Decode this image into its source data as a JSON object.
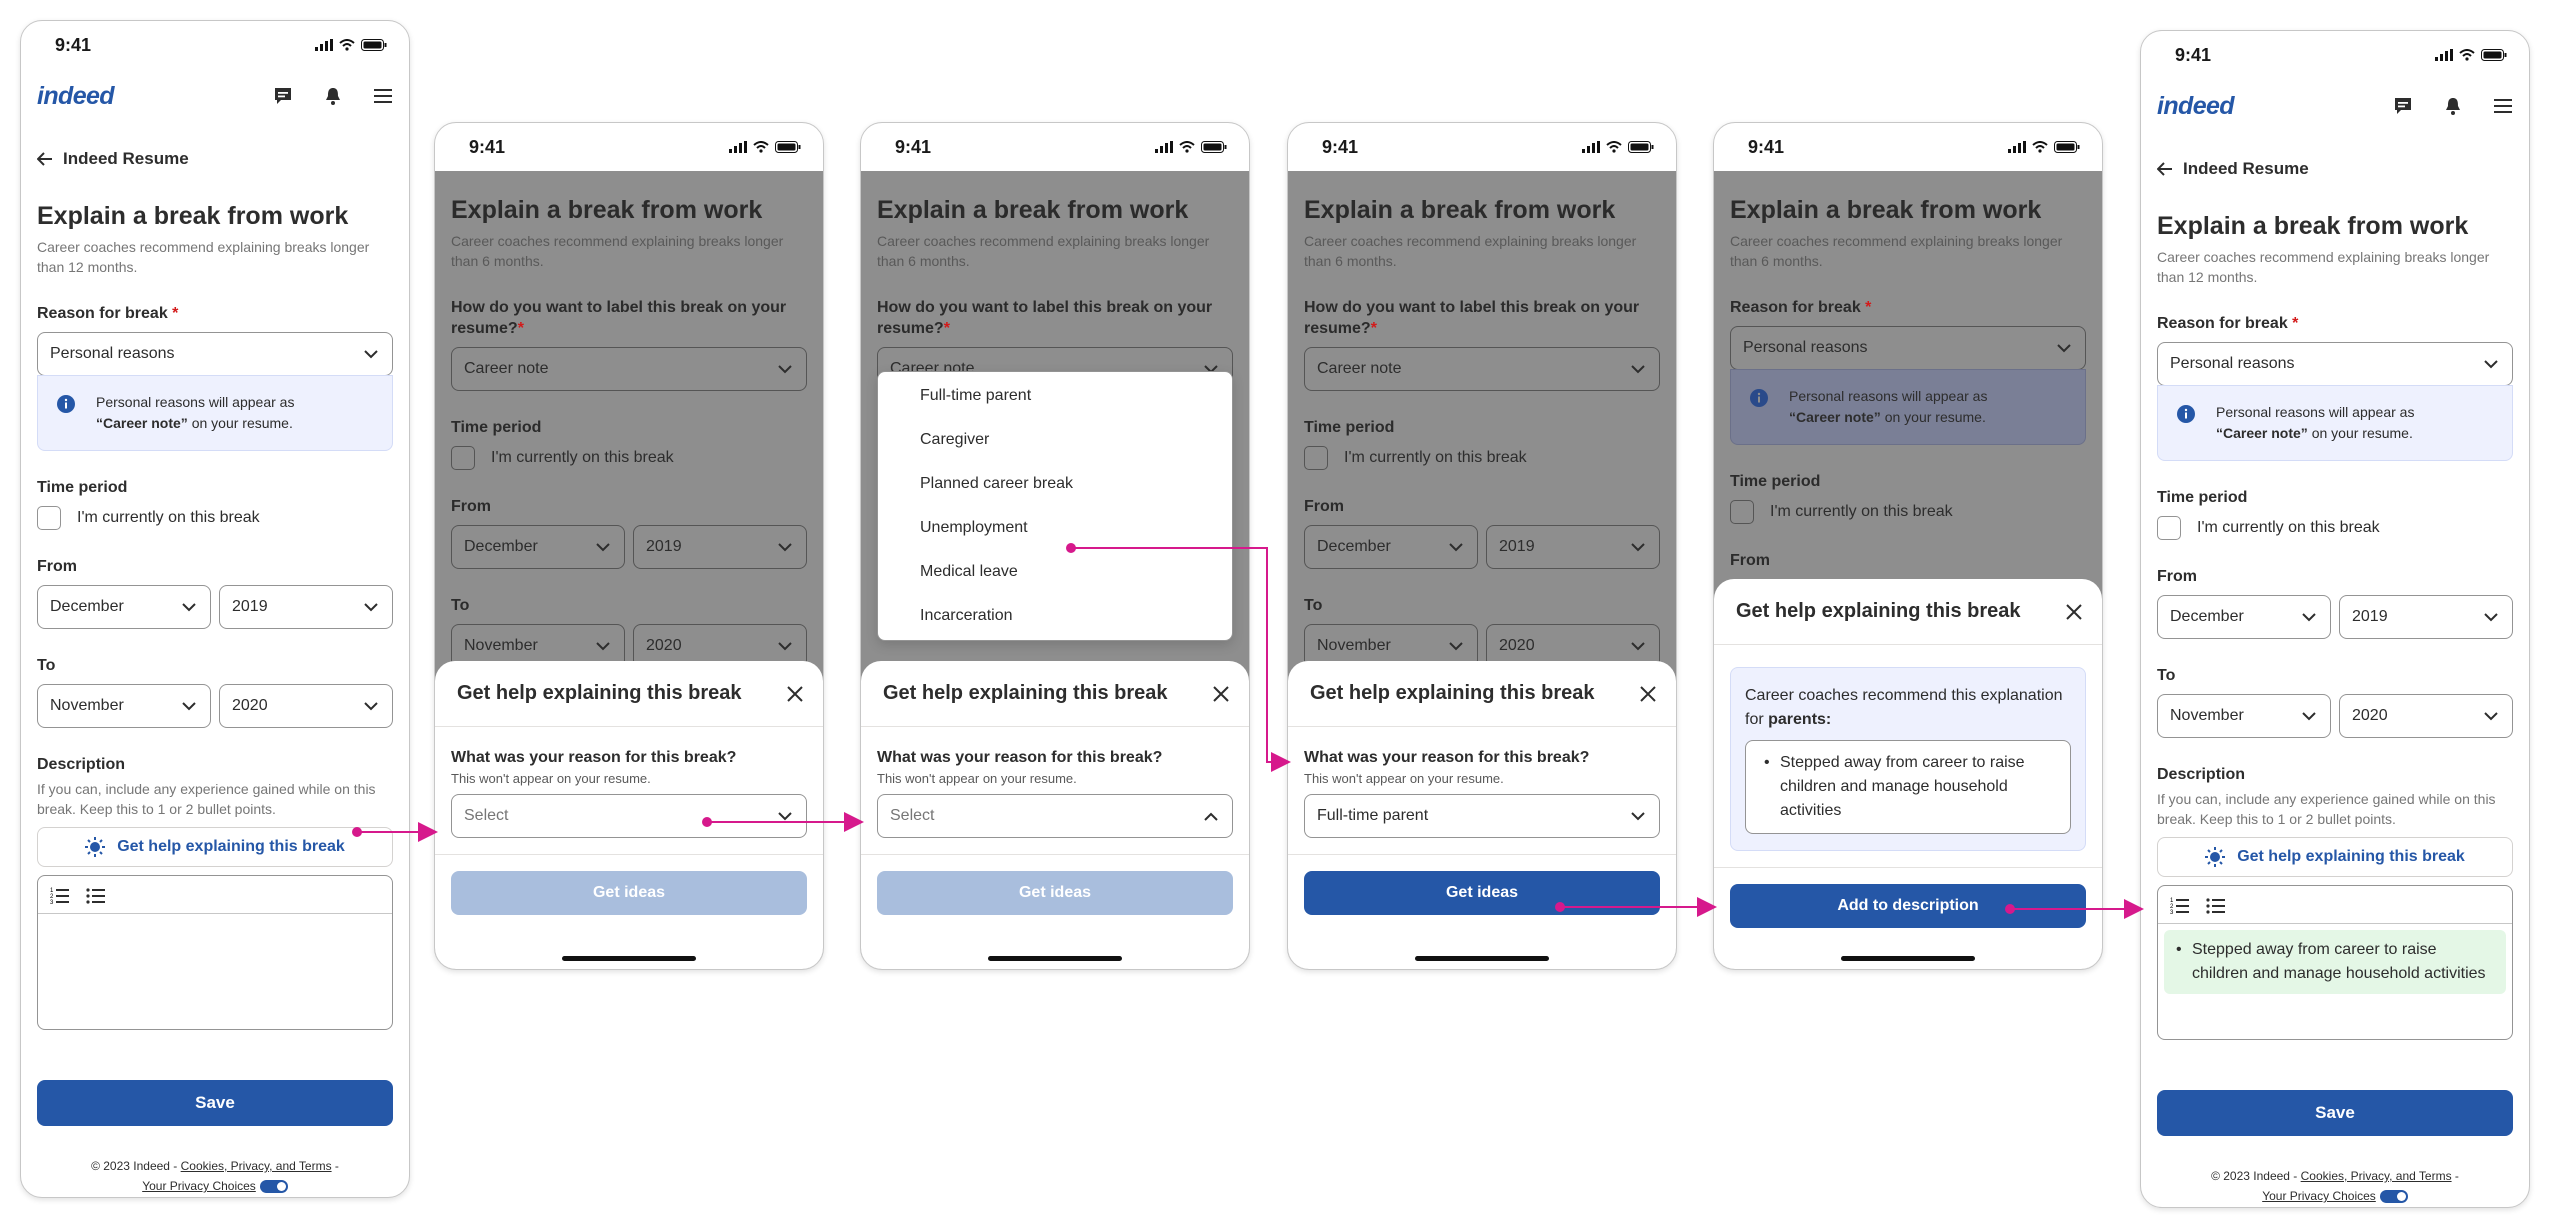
{
  "status": {
    "time": "9:41"
  },
  "app": {
    "logo": "indeed"
  },
  "page": {
    "back_label": "Indeed Resume",
    "title": "Explain a break from work",
    "subtitle": "Career coaches recommend explaining breaks longer than 12 months.",
    "subtitle_6": "Career coaches recommend explaining breaks longer than 6 months.",
    "reason_label": "Reason for break",
    "reason_value": "Personal reasons",
    "info_line1": "Personal reasons will appear as",
    "info_bold": "“Career note”",
    "info_line2": " on your resume.",
    "label_question": "How do you want to label this break on your resume?",
    "label_value": "Career note",
    "time_period_label": "Time period",
    "current_break_label": "I'm currently on this break",
    "from_label": "From",
    "from_month": "December",
    "from_year": "2019",
    "to_label": "To",
    "to_month": "November",
    "to_year": "2020",
    "description_label": "Description",
    "description_hint": "If you can, include any experience gained while on this break. Keep this to 1 or 2 bullet points.",
    "help_button": "Get help explaining this break",
    "description_bullet": "Stepped away from career to raise children and manage household activities",
    "save_button": "Save",
    "footer_copyright": "© 2023 Indeed - ",
    "footer_link": "Cookies, Privacy, and Terms",
    "footer_dash": " -",
    "footer_privacy": "Your Privacy Choices"
  },
  "sheet": {
    "title": "Get help explaining this break",
    "question": "What was your reason for this break?",
    "question_hint": "This won't appear on your resume.",
    "select_placeholder": "Select",
    "selected_value": "Full-time parent",
    "get_ideas": "Get ideas",
    "coach_intro": "Career coaches recommend this explanation for ",
    "coach_audience": "parents:",
    "suggestion": "Stepped away from career to raise children and manage household activities",
    "add_button": "Add to description"
  },
  "dropdown_options": [
    "Full-time parent",
    "Caregiver",
    "Planned career break",
    "Unemployment",
    "Medical leave",
    "Incarceration"
  ],
  "colors": {
    "brand": "#2557a7",
    "accent_arrow": "#d6198c",
    "required": "#d31a1a"
  }
}
